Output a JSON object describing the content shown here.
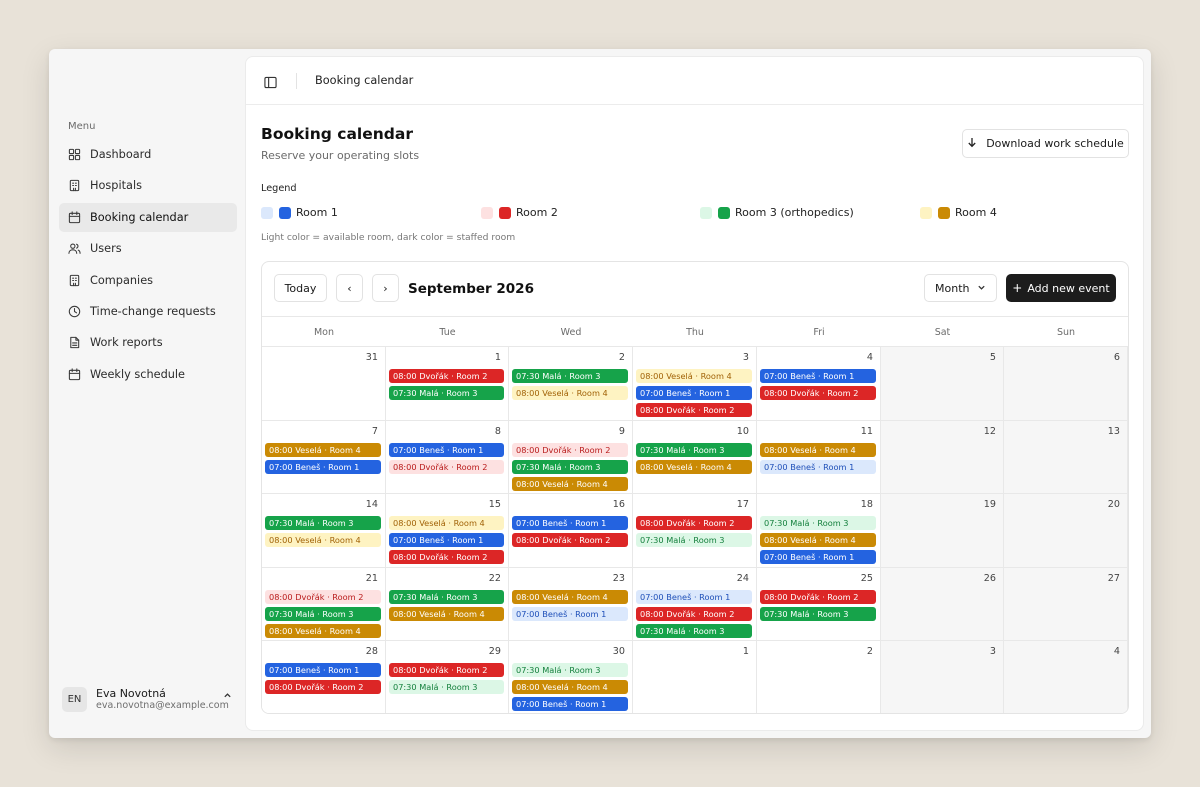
{
  "sidebar": {
    "menu_label": "Menu",
    "items": [
      {
        "label": "Dashboard",
        "icon": "grid-icon"
      },
      {
        "label": "Hospitals",
        "icon": "building-icon"
      },
      {
        "label": "Booking calendar",
        "icon": "calendar-icon",
        "active": true
      },
      {
        "label": "Users",
        "icon": "users-icon"
      },
      {
        "label": "Companies",
        "icon": "building-icon"
      },
      {
        "label": "Time-change requests",
        "icon": "clock-icon"
      },
      {
        "label": "Work reports",
        "icon": "file-icon"
      },
      {
        "label": "Weekly schedule",
        "icon": "calendar-icon"
      }
    ],
    "user": {
      "initials": "EN",
      "name": "Eva Novotná",
      "email": "eva.novotna@example.com"
    }
  },
  "topbar": {
    "breadcrumb": "Booking calendar"
  },
  "header": {
    "title": "Booking calendar",
    "subtitle": "Reserve your operating slots",
    "download_label": "Download work schedule"
  },
  "legend": {
    "title": "Legend",
    "note": "Light color = available room, dark color = staffed room",
    "rooms": [
      {
        "label": "Room 1",
        "light": "#dbe8fc",
        "dark": "#2463e0"
      },
      {
        "label": "Room 2",
        "light": "#fde1e1",
        "dark": "#dc2626"
      },
      {
        "label": "Room 3 (orthopedics)",
        "light": "#dcf7e6",
        "dark": "#16a34a"
      },
      {
        "label": "Room 4",
        "light": "#fef3c2",
        "dark": "#ca8a04"
      }
    ]
  },
  "calendar": {
    "today_label": "Today",
    "prev_label": "‹",
    "next_label": "›",
    "month_title": "September 2026",
    "view_label": "Month",
    "add_label": "Add new event",
    "weekdays": [
      "Mon",
      "Tue",
      "Wed",
      "Thu",
      "Fri",
      "Sat",
      "Sun"
    ],
    "weeks": [
      [
        {
          "day": "31",
          "events": []
        },
        {
          "day": "1",
          "events": [
            {
              "text": "08:00 Dvořák · Room 2",
              "room": 1,
              "staffed": true
            },
            {
              "text": "07:30 Malá · Room 3",
              "room": 2,
              "staffed": true
            }
          ]
        },
        {
          "day": "2",
          "events": [
            {
              "text": "07:30 Malá · Room 3",
              "room": 2,
              "staffed": true
            },
            {
              "text": "08:00 Veselá · Room 4",
              "room": 3,
              "staffed": false
            }
          ]
        },
        {
          "day": "3",
          "events": [
            {
              "text": "08:00 Veselá · Room 4",
              "room": 3,
              "staffed": false
            },
            {
              "text": "07:00 Beneš · Room 1",
              "room": 0,
              "staffed": true
            },
            {
              "text": "08:00 Dvořák · Room 2",
              "room": 1,
              "staffed": true
            }
          ]
        },
        {
          "day": "4",
          "events": [
            {
              "text": "07:00 Beneš · Room 1",
              "room": 0,
              "staffed": true
            },
            {
              "text": "08:00 Dvořák · Room 2",
              "room": 1,
              "staffed": true
            }
          ]
        },
        {
          "day": "5",
          "events": []
        },
        {
          "day": "6",
          "events": []
        }
      ],
      [
        {
          "day": "7",
          "events": [
            {
              "text": "08:00 Veselá · Room 4",
              "room": 3,
              "staffed": true
            },
            {
              "text": "07:00 Beneš · Room 1",
              "room": 0,
              "staffed": true
            }
          ]
        },
        {
          "day": "8",
          "events": [
            {
              "text": "07:00 Beneš · Room 1",
              "room": 0,
              "staffed": true
            },
            {
              "text": "08:00 Dvořák · Room 2",
              "room": 1,
              "staffed": false
            }
          ]
        },
        {
          "day": "9",
          "events": [
            {
              "text": "08:00 Dvořák · Room 2",
              "room": 1,
              "staffed": false
            },
            {
              "text": "07:30 Malá · Room 3",
              "room": 2,
              "staffed": true
            },
            {
              "text": "08:00 Veselá · Room 4",
              "room": 3,
              "staffed": true
            }
          ]
        },
        {
          "day": "10",
          "events": [
            {
              "text": "07:30 Malá · Room 3",
              "room": 2,
              "staffed": true
            },
            {
              "text": "08:00 Veselá · Room 4",
              "room": 3,
              "staffed": true
            }
          ]
        },
        {
          "day": "11",
          "events": [
            {
              "text": "08:00 Veselá · Room 4",
              "room": 3,
              "staffed": true
            },
            {
              "text": "07:00 Beneš · Room 1",
              "room": 0,
              "staffed": false
            }
          ]
        },
        {
          "day": "12",
          "events": []
        },
        {
          "day": "13",
          "events": []
        }
      ],
      [
        {
          "day": "14",
          "events": [
            {
              "text": "07:30 Malá · Room 3",
              "room": 2,
              "staffed": true
            },
            {
              "text": "08:00 Veselá · Room 4",
              "room": 3,
              "staffed": false
            }
          ]
        },
        {
          "day": "15",
          "events": [
            {
              "text": "08:00 Veselá · Room 4",
              "room": 3,
              "staffed": false
            },
            {
              "text": "07:00 Beneš · Room 1",
              "room": 0,
              "staffed": true
            },
            {
              "text": "08:00 Dvořák · Room 2",
              "room": 1,
              "staffed": true
            }
          ]
        },
        {
          "day": "16",
          "events": [
            {
              "text": "07:00 Beneš · Room 1",
              "room": 0,
              "staffed": true
            },
            {
              "text": "08:00 Dvořák · Room 2",
              "room": 1,
              "staffed": true
            }
          ]
        },
        {
          "day": "17",
          "events": [
            {
              "text": "08:00 Dvořák · Room 2",
              "room": 1,
              "staffed": true
            },
            {
              "text": "07:30 Malá · Room 3",
              "room": 2,
              "staffed": false
            }
          ]
        },
        {
          "day": "18",
          "events": [
            {
              "text": "07:30 Malá · Room 3",
              "room": 2,
              "staffed": false
            },
            {
              "text": "08:00 Veselá · Room 4",
              "room": 3,
              "staffed": true
            },
            {
              "text": "07:00 Beneš · Room 1",
              "room": 0,
              "staffed": true
            }
          ]
        },
        {
          "day": "19",
          "events": []
        },
        {
          "day": "20",
          "events": []
        }
      ],
      [
        {
          "day": "21",
          "events": [
            {
              "text": "08:00 Dvořák · Room 2",
              "room": 1,
              "staffed": false
            },
            {
              "text": "07:30 Malá · Room 3",
              "room": 2,
              "staffed": true
            },
            {
              "text": "08:00 Veselá · Room 4",
              "room": 3,
              "staffed": true
            }
          ]
        },
        {
          "day": "22",
          "events": [
            {
              "text": "07:30 Malá · Room 3",
              "room": 2,
              "staffed": true
            },
            {
              "text": "08:00 Veselá · Room 4",
              "room": 3,
              "staffed": true
            }
          ]
        },
        {
          "day": "23",
          "events": [
            {
              "text": "08:00 Veselá · Room 4",
              "room": 3,
              "staffed": true
            },
            {
              "text": "07:00 Beneš · Room 1",
              "room": 0,
              "staffed": false
            }
          ]
        },
        {
          "day": "24",
          "events": [
            {
              "text": "07:00 Beneš · Room 1",
              "room": 0,
              "staffed": false
            },
            {
              "text": "08:00 Dvořák · Room 2",
              "room": 1,
              "staffed": true
            },
            {
              "text": "07:30 Malá · Room 3",
              "room": 2,
              "staffed": true
            }
          ]
        },
        {
          "day": "25",
          "events": [
            {
              "text": "08:00 Dvořák · Room 2",
              "room": 1,
              "staffed": true
            },
            {
              "text": "07:30 Malá · Room 3",
              "room": 2,
              "staffed": true
            }
          ]
        },
        {
          "day": "26",
          "events": []
        },
        {
          "day": "27",
          "events": []
        }
      ],
      [
        {
          "day": "28",
          "events": [
            {
              "text": "07:00 Beneš · Room 1",
              "room": 0,
              "staffed": true
            },
            {
              "text": "08:00 Dvořák · Room 2",
              "room": 1,
              "staffed": true
            }
          ]
        },
        {
          "day": "29",
          "events": [
            {
              "text": "08:00 Dvořák · Room 2",
              "room": 1,
              "staffed": true
            },
            {
              "text": "07:30 Malá · Room 3",
              "room": 2,
              "staffed": false
            }
          ]
        },
        {
          "day": "30",
          "events": [
            {
              "text": "07:30 Malá · Room 3",
              "room": 2,
              "staffed": false
            },
            {
              "text": "08:00 Veselá · Room 4",
              "room": 3,
              "staffed": true
            },
            {
              "text": "07:00 Beneš · Room 1",
              "room": 0,
              "staffed": true
            }
          ]
        },
        {
          "day": "1",
          "events": []
        },
        {
          "day": "2",
          "events": []
        },
        {
          "day": "3",
          "events": []
        },
        {
          "day": "4",
          "events": []
        }
      ]
    ]
  },
  "colors": {
    "room_text_light": [
      "#1e4fb8",
      "#b91c1c",
      "#15803d",
      "#a16207"
    ]
  }
}
